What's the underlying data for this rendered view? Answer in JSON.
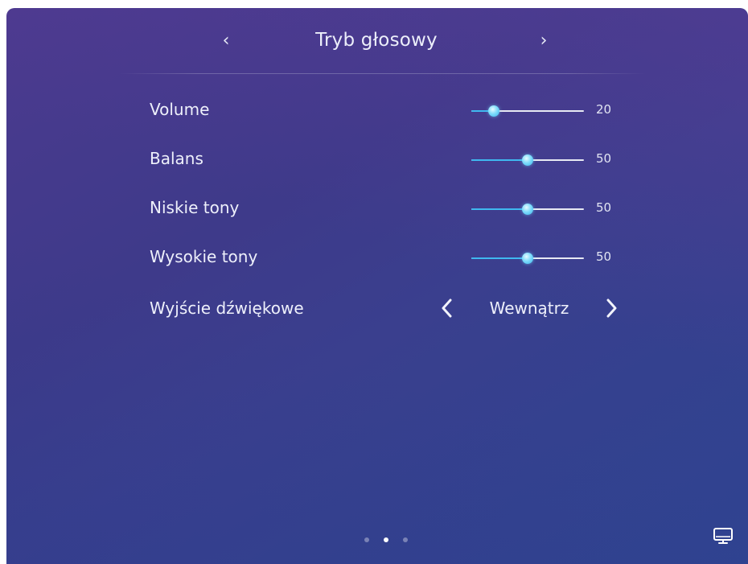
{
  "header": {
    "title": "Tryb głosowy",
    "prev_icon": "chevron-left-icon",
    "next_icon": "chevron-right-icon"
  },
  "settings": {
    "volume": {
      "label": "Volume",
      "value": "20",
      "level": 20
    },
    "balance": {
      "label": "Balans",
      "value": "50",
      "level": 50
    },
    "bass": {
      "label": "Niskie tony",
      "value": "50",
      "level": 50
    },
    "treble": {
      "label": "Wysokie tony",
      "value": "50",
      "level": 50
    },
    "audio_output": {
      "label": "Wyjście dźwiękowe",
      "value": "Wewnątrz"
    }
  },
  "pagination": {
    "count": 3,
    "active_index": 1
  },
  "footer": {
    "icon": "monitor-icon"
  },
  "colors": {
    "accent": "#3fb8f0",
    "track": "#e7e9f3",
    "text": "#eef0fb"
  }
}
